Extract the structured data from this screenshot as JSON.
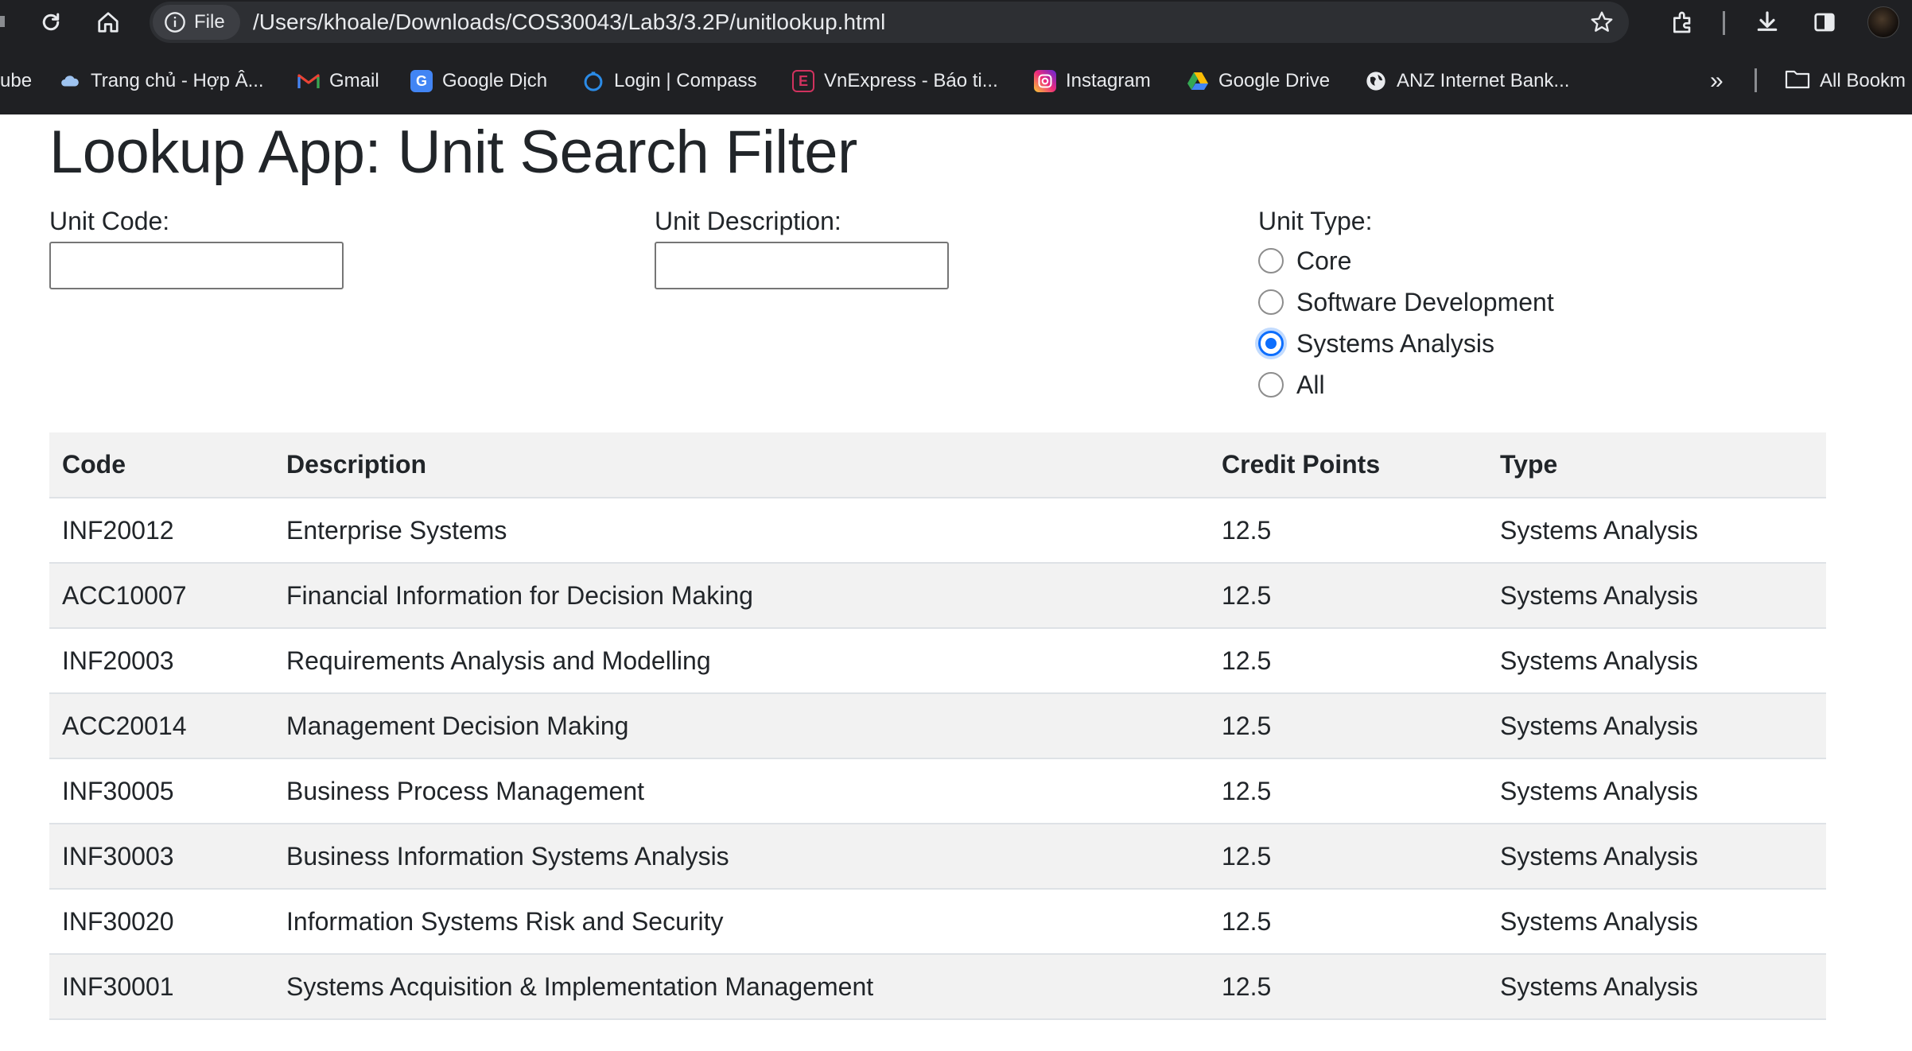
{
  "browser": {
    "chip_label": "File",
    "url": "/Users/khoale/Downloads/COS30043/Lab3/3.2P/unitlookup.html",
    "bookmarks": [
      {
        "label": "ube",
        "icon": "none"
      },
      {
        "label": "Trang chủ - Hợp Â...",
        "icon": "cloud-icon"
      },
      {
        "label": "Gmail",
        "icon": "gmail-icon"
      },
      {
        "label": "Google Dịch",
        "icon": "translate-icon"
      },
      {
        "label": "Login | Compass",
        "icon": "compass-icon"
      },
      {
        "label": "VnExpress - Báo ti...",
        "icon": "vnexpress-icon"
      },
      {
        "label": "Instagram",
        "icon": "instagram-icon"
      },
      {
        "label": "Google Drive",
        "icon": "drive-icon"
      },
      {
        "label": "ANZ Internet Bank...",
        "icon": "globe-icon"
      }
    ],
    "overflow_label": "»",
    "all_bookmarks_label": "All Bookm"
  },
  "page": {
    "title": "Lookup App: Unit Search Filter",
    "unit_code_label": "Unit Code:",
    "unit_code_value": "",
    "unit_description_label": "Unit Description:",
    "unit_description_value": "",
    "unit_type_label": "Unit Type:",
    "unit_type_options": [
      "Core",
      "Software Development",
      "Systems Analysis",
      "All"
    ],
    "unit_type_selected": "Systems Analysis"
  },
  "table": {
    "headers": [
      "Code",
      "Description",
      "Credit Points",
      "Type"
    ],
    "rows": [
      [
        "INF20012",
        "Enterprise Systems",
        "12.5",
        "Systems Analysis"
      ],
      [
        "ACC10007",
        "Financial Information for Decision Making",
        "12.5",
        "Systems Analysis"
      ],
      [
        "INF20003",
        "Requirements Analysis and Modelling",
        "12.5",
        "Systems Analysis"
      ],
      [
        "ACC20014",
        "Management Decision Making",
        "12.5",
        "Systems Analysis"
      ],
      [
        "INF30005",
        "Business Process Management",
        "12.5",
        "Systems Analysis"
      ],
      [
        "INF30003",
        "Business Information Systems Analysis",
        "12.5",
        "Systems Analysis"
      ],
      [
        "INF30020",
        "Information Systems Risk and Security",
        "12.5",
        "Systems Analysis"
      ],
      [
        "INF30001",
        "Systems Acquisition & Implementation Management",
        "12.5",
        "Systems Analysis"
      ]
    ]
  },
  "colors": {
    "chrome_bg": "#1f2023",
    "accent": "#0d6efd",
    "row_stripe": "#f2f2f2"
  }
}
